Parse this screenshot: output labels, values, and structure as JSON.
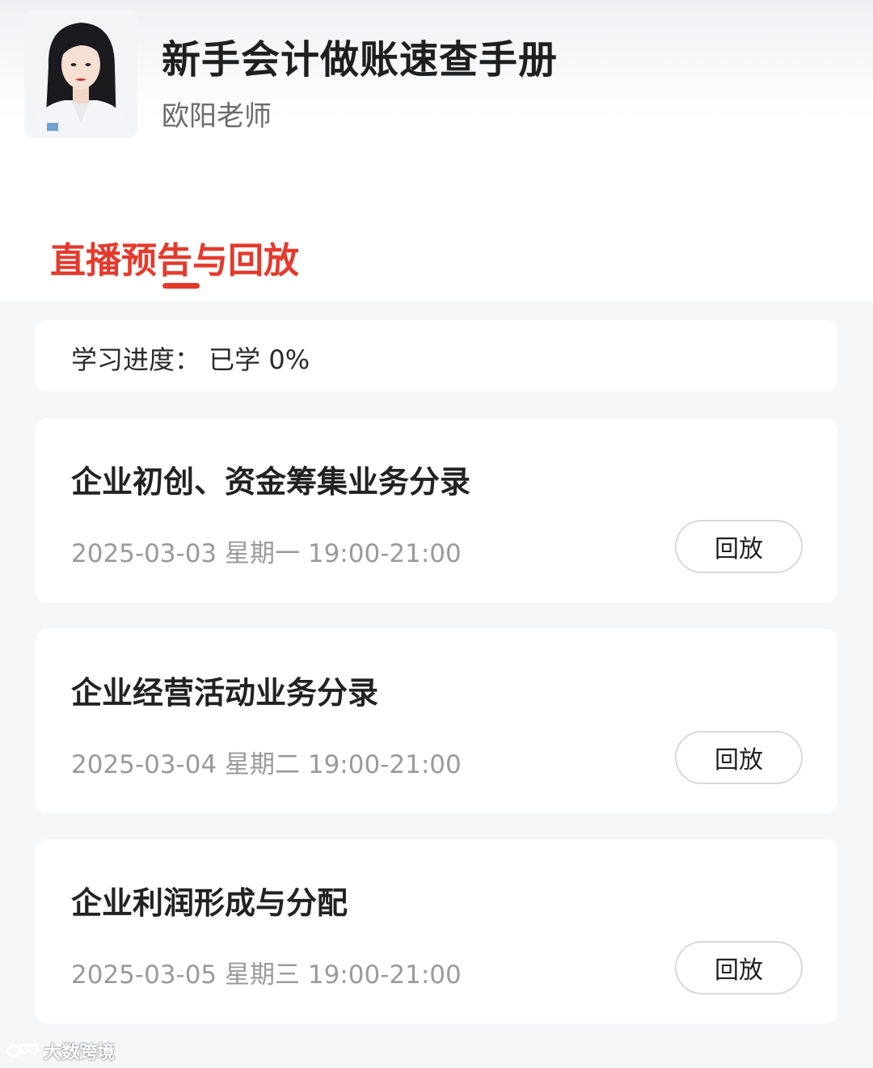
{
  "course": {
    "title": "新手会计做账速查手册",
    "teacher": "欧阳老师"
  },
  "tab": {
    "label": "直播预告与回放"
  },
  "progress": {
    "text": "学习进度：  已学 0%"
  },
  "lessons": [
    {
      "title": "企业初创、资金筹集业务分录",
      "time": "2025-03-03 星期一 19:00-21:00",
      "button": "回放"
    },
    {
      "title": "企业经营活动业务分录",
      "time": "2025-03-04 星期二 19:00-21:00",
      "button": "回放"
    },
    {
      "title": "企业利润形成与分配",
      "time": "2025-03-05 星期三 19:00-21:00",
      "button": "回放"
    }
  ],
  "watermark": {
    "text": "大数跨境"
  },
  "colors": {
    "accent": "#e43a2c",
    "muted": "#9a9a9a"
  }
}
